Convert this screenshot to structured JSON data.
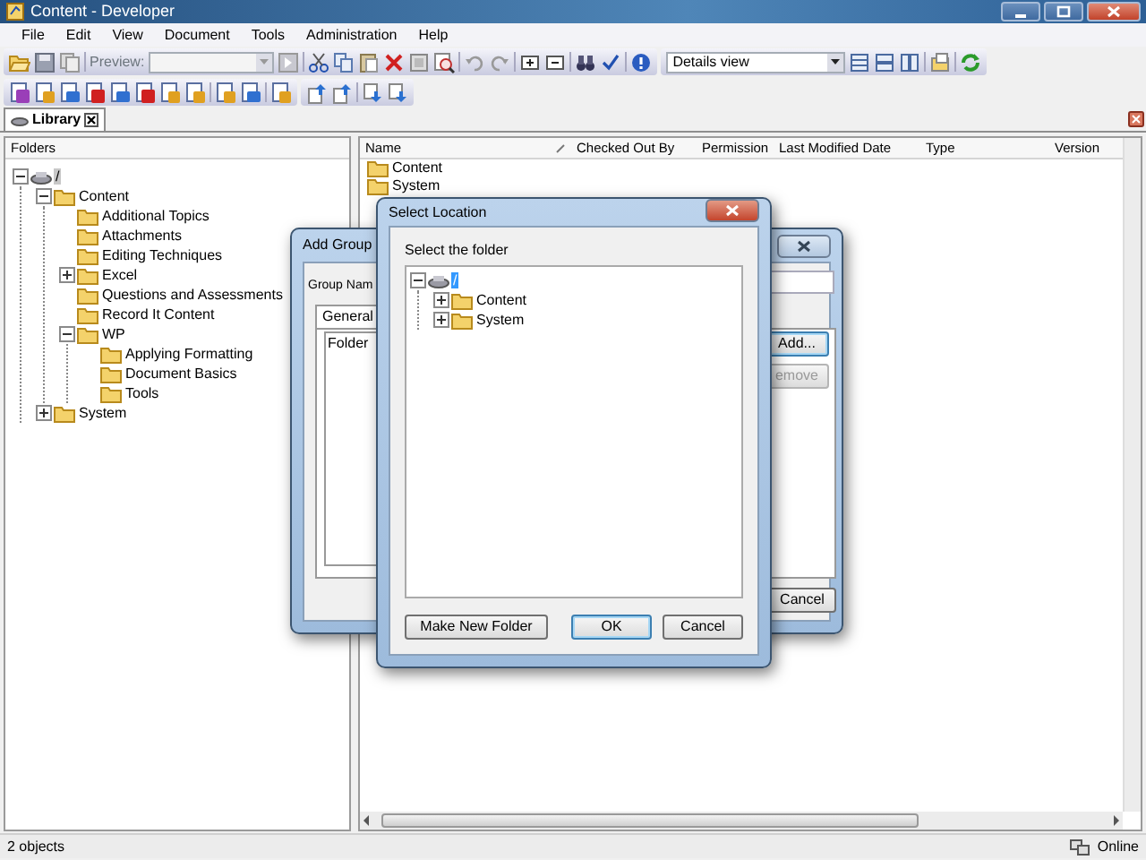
{
  "window": {
    "title": "Content - Developer"
  },
  "menu": [
    "File",
    "Edit",
    "View",
    "Document",
    "Tools",
    "Administration",
    "Help"
  ],
  "toolbar": {
    "preview_label": "Preview:",
    "view_select": "Details view"
  },
  "doc_tab": {
    "label": "Library"
  },
  "folders": {
    "header": "Folders",
    "tree": [
      {
        "label": "/",
        "kind": "root",
        "selected": true,
        "expanded": true,
        "children": [
          {
            "label": "Content",
            "expanded": true,
            "selected": false,
            "children": [
              {
                "label": "Additional Topics",
                "selected": false
              },
              {
                "label": "Attachments",
                "selected": false
              },
              {
                "label": "Editing Techniques",
                "selected": false
              },
              {
                "label": "Excel",
                "expanded": false,
                "selected": false
              },
              {
                "label": "Questions and Assessments",
                "selected": false
              },
              {
                "label": "Record It Content",
                "selected": false
              },
              {
                "label": "WP",
                "expanded": true,
                "selected": false,
                "children": [
                  {
                    "label": "Applying Formatting",
                    "selected": false
                  },
                  {
                    "label": "Document Basics",
                    "selected": false
                  },
                  {
                    "label": "Tools",
                    "selected": false
                  }
                ]
              }
            ]
          },
          {
            "label": "System",
            "expanded": false,
            "selected": false
          }
        ]
      }
    ]
  },
  "list": {
    "columns": [
      "Name",
      "Checked Out By",
      "Permission",
      "Last Modified Date",
      "Type",
      "Version"
    ],
    "rows": [
      {
        "name": "Content"
      },
      {
        "name": "System"
      }
    ]
  },
  "add_group_dialog": {
    "title": "Add Group",
    "group_name_label": "Group Nam",
    "tabs": [
      {
        "label": "General",
        "selected": true
      }
    ],
    "list_header": "Folder",
    "buttons": [
      {
        "label": "Add...",
        "disabled": false,
        "focused": true
      },
      {
        "label": "emove",
        "disabled": true,
        "focused": false
      }
    ],
    "cancel": "Cancel"
  },
  "select_location_dialog": {
    "title": "Select Location",
    "prompt": "Select the folder",
    "tree": [
      {
        "label": "/",
        "kind": "root",
        "selected": true,
        "expanded": true,
        "children": [
          {
            "label": "Content",
            "expanded": false,
            "selected": false
          },
          {
            "label": "System",
            "expanded": false,
            "selected": false
          }
        ]
      }
    ],
    "buttons": [
      {
        "label": "Make New Folder",
        "focused": false
      },
      {
        "label": "OK",
        "focused": true
      },
      {
        "label": "Cancel",
        "focused": false
      }
    ]
  },
  "status_bar": {
    "count": "2 objects",
    "connection": "Online"
  }
}
